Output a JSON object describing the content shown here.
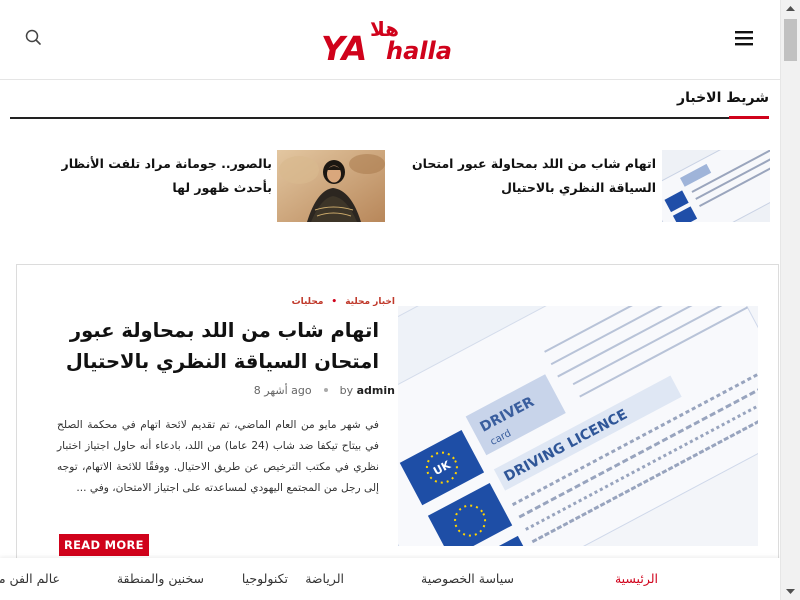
{
  "header": {
    "logo_text_ya": "YA",
    "logo_text_halla": "halla",
    "logo_arabic": "هلا"
  },
  "ticker": {
    "title": "شريط الاخبار",
    "items": [
      {
        "title": "اتهام شاب من اللد بمحاولة عبور امتحان السياقة النظري بالاحتيال"
      },
      {
        "title": "بالصور.. جومانة مراد تلفت الأنظار بأحدث ظهور لها"
      }
    ]
  },
  "article": {
    "categories": [
      "اخبار محلية",
      "محليات"
    ],
    "title": "اتهام شاب من اللد بمحاولة عبور امتحان السياقة النظري بالاحتيال",
    "author_prefix": "by",
    "author": "admin",
    "time_ago": "8 أشهر ago",
    "excerpt": "في شهر مايو من العام الماضي، تم تقديم لائحة اتهام في محكمة الصلح في بيتاح تيكفا ضد شاب (24 عاما) من اللد، بادعاء أنه حاول اجتياز اختبار نظري في مكتب الترخيص عن طريق الاحتيال. ووفقًا للائحة الاتهام، توجه إلى رجل من المجتمع اليهودي لمساعدته على اجتياز الامتحان، وفي ...",
    "read_more": "READ MORE",
    "image_texts": {
      "driver": "DRIVER",
      "card": "card",
      "licence": "DRIVING LICENCE",
      "uk": "UK"
    }
  },
  "bottom_nav": {
    "items": [
      {
        "label": "الرئيسية",
        "active": true
      },
      {
        "label": "سياسة الخصوصية",
        "active": false
      },
      {
        "label": "الرياضة",
        "active": false
      },
      {
        "label": "تكنولوجيا",
        "active": false
      },
      {
        "label": "سخنين والمنطقة",
        "active": false
      },
      {
        "label": "عالم الفن محليات",
        "active": false
      }
    ]
  },
  "colors": {
    "accent": "#d0021b",
    "text": "#111111",
    "border": "#dcdcdc"
  },
  "icons": {
    "search": "search-icon",
    "menu": "hamburger-menu-icon"
  }
}
